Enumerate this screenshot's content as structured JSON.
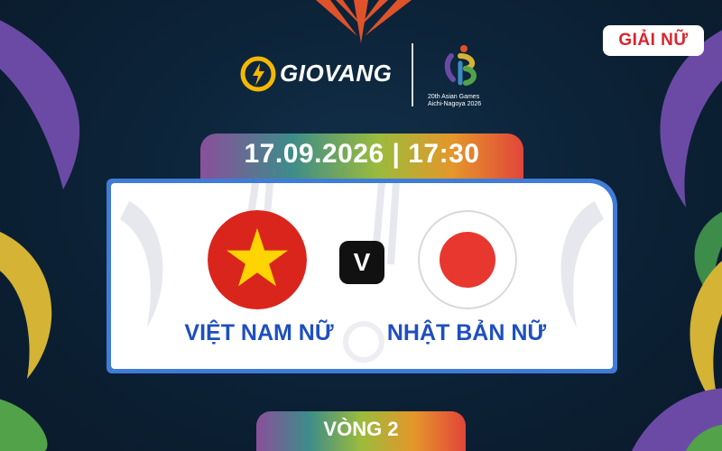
{
  "badge": {
    "label": "GIẢI NỮ"
  },
  "brand": {
    "name": "GIOVANG"
  },
  "games": {
    "caption_line1": "20th Asian Games",
    "caption_line2": "Aichi-Nagoya 2026"
  },
  "match": {
    "date": "17.09.2026",
    "time": "17:30",
    "separator": "|",
    "vs_label": "V",
    "home": {
      "name": "VIỆT NAM NỮ",
      "flag": "vietnam-flag-icon"
    },
    "away": {
      "name": "NHẬT BẢN NỮ",
      "flag": "japan-flag-icon"
    }
  },
  "round": {
    "label": "VÒNG 2"
  },
  "colors": {
    "background": "#0c2338",
    "card_border": "#3f7cd8",
    "team_text": "#1e4fbe",
    "badge_text": "#d9252d",
    "vn_red": "#da251d",
    "vn_star": "#ffd400",
    "jp_red": "#e8372f"
  }
}
